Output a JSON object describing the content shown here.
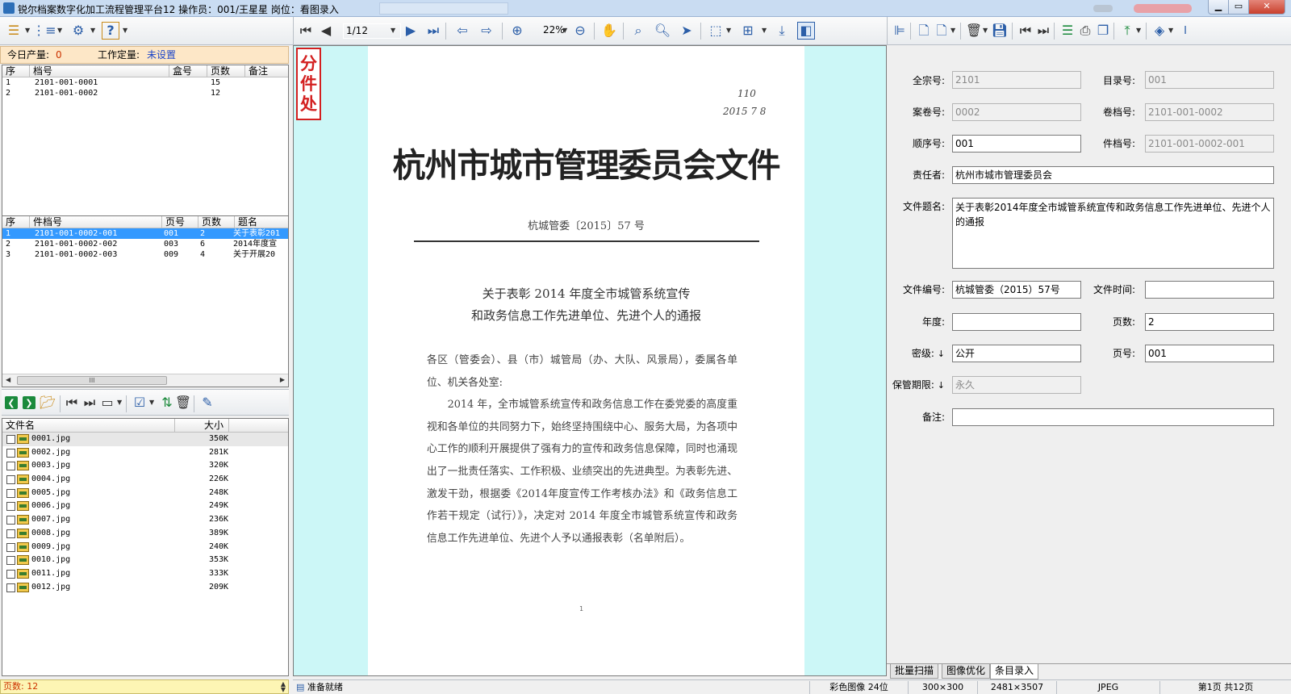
{
  "window": {
    "title": "锐尔档案数字化加工流程管理平台12   操作员：001/王星星   岗位：看图录入"
  },
  "viewer_toolbar": {
    "page_indicator": "1/12",
    "zoom": "22%"
  },
  "production": {
    "today_label": "今日产量:",
    "today_value": "0",
    "quota_label": "工作定量:",
    "quota_value": "未设置"
  },
  "volumes_table": {
    "columns": [
      "序",
      "档号",
      "盒号",
      "页数",
      "备注"
    ],
    "rows": [
      {
        "seq": "1",
        "code": "2101-001-0001",
        "box": "",
        "pages": "15",
        "note": ""
      },
      {
        "seq": "2",
        "code": "2101-001-0002",
        "box": "",
        "pages": "12",
        "note": ""
      }
    ]
  },
  "items_table": {
    "columns": [
      "序",
      "件档号",
      "页号",
      "页数",
      "题名"
    ],
    "rows": [
      {
        "seq": "1",
        "code": "2101-001-0002-001",
        "page_no": "001",
        "pages": "2",
        "title": "关于表彰201"
      },
      {
        "seq": "2",
        "code": "2101-001-0002-002",
        "page_no": "003",
        "pages": "6",
        "title": "2014年度宣"
      },
      {
        "seq": "3",
        "code": "2101-001-0002-003",
        "page_no": "009",
        "pages": "4",
        "title": "关于开展20"
      }
    ],
    "selected_index": 0,
    "scroll_thumb": "III"
  },
  "files_table": {
    "columns": [
      "文件名",
      "大小"
    ],
    "rows": [
      {
        "name": "0001.jpg",
        "size": "350K"
      },
      {
        "name": "0002.jpg",
        "size": "281K"
      },
      {
        "name": "0003.jpg",
        "size": "320K"
      },
      {
        "name": "0004.jpg",
        "size": "226K"
      },
      {
        "name": "0005.jpg",
        "size": "248K"
      },
      {
        "name": "0006.jpg",
        "size": "249K"
      },
      {
        "name": "0007.jpg",
        "size": "236K"
      },
      {
        "name": "0008.jpg",
        "size": "389K"
      },
      {
        "name": "0009.jpg",
        "size": "240K"
      },
      {
        "name": "0010.jpg",
        "size": "353K"
      },
      {
        "name": "0011.jpg",
        "size": "333K"
      },
      {
        "name": "0012.jpg",
        "size": "209K"
      }
    ]
  },
  "left_status": "页数: 12",
  "split_label": "分件处",
  "document": {
    "handwriting_1": "110",
    "handwriting_2": "2015  7  8",
    "header": "杭州市城市管理委员会文件",
    "number": "杭城管委〔2015〕57 号",
    "title_line1": "关于表彰 2014 年度全市城管系统宣传",
    "title_line2": "和政务信息工作先进单位、先进个人的通报",
    "salutation": "各区（管委会）、县（市）城管局（办、大队、风景局），委属各单位、机关各处室:",
    "paragraph": "2014 年，全市城管系统宣传和政务信息工作在委党委的高度重视和各单位的共同努力下，始终坚持围绕中心、服务大局，为各项中心工作的顺利开展提供了强有力的宣传和政务信息保障，同时也涌现出了一批责任落实、工作积极、业绩突出的先进典型。为表彰先进、激发干劲，根据委《2014年度宣传工作考核办法》和《政务信息工作若干规定（试行）》，决定对 2014 年度全市城管系统宣传和政务信息工作先进单位、先进个人予以通报表彰（名单附后）。",
    "page_mark": "1"
  },
  "form": {
    "fonds_label": "全宗号:",
    "fonds_value": "2101",
    "catalog_label": "目录号:",
    "catalog_value": "001",
    "case_label": "案卷号:",
    "case_value": "0002",
    "volume_label": "卷档号:",
    "volume_value": "2101-001-0002",
    "order_label": "顺序号:",
    "order_value": "001",
    "item_label": "件档号:",
    "item_value": "2101-001-0002-001",
    "responsible_label": "责任者:",
    "responsible_value": "杭州市城市管理委员会",
    "title_label": "文件题名:",
    "title_value": "关于表彰2014年度全市城管系统宣传和政务信息工作先进单位、先进个人的通报",
    "docno_label": "文件编号:",
    "docno_value": "杭城管委（2015）57号",
    "doctime_label": "文件时间:",
    "doctime_value": "",
    "year_label": "年度:",
    "year_value": "",
    "pages_label": "页数:",
    "pages_value": "2",
    "secret_label": "密级:",
    "secret_arrow": "↓",
    "secret_value": "公开",
    "pageno_label": "页号:",
    "pageno_value": "001",
    "retention_label": "保管期限:",
    "retention_arrow": "↓",
    "retention_value": "永久",
    "remark_label": "备注:",
    "remark_value": ""
  },
  "tabs": [
    "批量扫描",
    "图像优化",
    "条目录入"
  ],
  "active_tab": 2,
  "statusbar": {
    "ready": "准备就绪",
    "color_mode": "彩色图像 24位",
    "dpi": "300×300",
    "dimensions": "2481×3507",
    "format": "JPEG",
    "page_info": "第1页 共12页"
  },
  "colors": {
    "viewer_bg": "#ccf7f7",
    "selection": "#3399ff",
    "split_label": "#d32020",
    "production_bg": "#fde7c7"
  }
}
